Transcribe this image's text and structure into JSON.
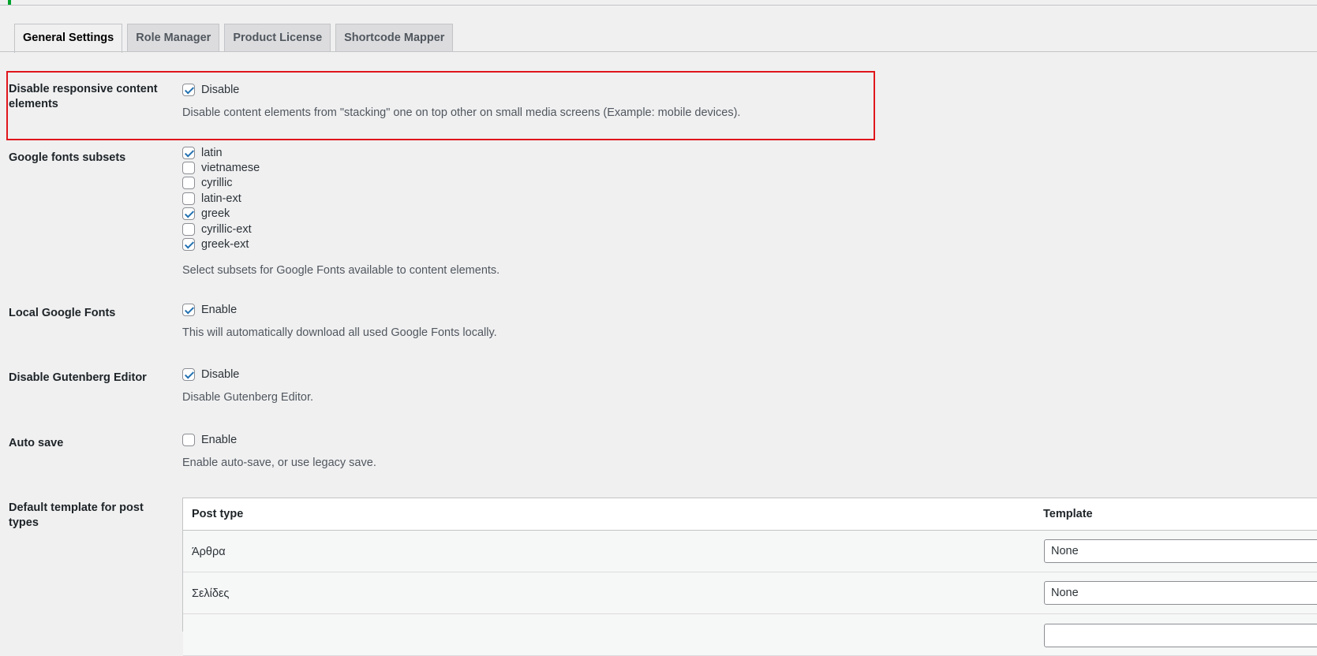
{
  "tabs": [
    {
      "label": "General Settings",
      "active": true
    },
    {
      "label": "Role Manager",
      "active": false
    },
    {
      "label": "Product License",
      "active": false
    },
    {
      "label": "Shortcode Mapper",
      "active": false
    }
  ],
  "settings": {
    "responsive": {
      "label": "Disable responsive content elements",
      "option": "Disable",
      "checked": true,
      "desc": "Disable content elements from \"stacking\" one on top other on small media screens (Example: mobile devices)."
    },
    "subsets": {
      "label": "Google fonts subsets",
      "options": [
        {
          "label": "latin",
          "checked": true
        },
        {
          "label": "vietnamese",
          "checked": false
        },
        {
          "label": "cyrillic",
          "checked": false
        },
        {
          "label": "latin-ext",
          "checked": false
        },
        {
          "label": "greek",
          "checked": true
        },
        {
          "label": "cyrillic-ext",
          "checked": false
        },
        {
          "label": "greek-ext",
          "checked": true
        }
      ],
      "desc": "Select subsets for Google Fonts available to content elements."
    },
    "local_fonts": {
      "label": "Local Google Fonts",
      "option": "Enable",
      "checked": true,
      "desc": "This will automatically download all used Google Fonts locally."
    },
    "gutenberg": {
      "label": "Disable Gutenberg Editor",
      "option": "Disable",
      "checked": true,
      "desc": "Disable Gutenberg Editor."
    },
    "autosave": {
      "label": "Auto save",
      "option": "Enable",
      "checked": false,
      "desc": "Enable auto-save, or use legacy save."
    },
    "templates": {
      "label": "Default template for post types",
      "col_post_type": "Post type",
      "col_template": "Template",
      "rows": [
        {
          "post_type": "Άρθρα",
          "template": "None"
        },
        {
          "post_type": "Σελίδες",
          "template": "None"
        }
      ]
    }
  },
  "colors": {
    "highlight": "#e0161b",
    "accent": "#00a32a",
    "checkbox": "#2271b1"
  }
}
